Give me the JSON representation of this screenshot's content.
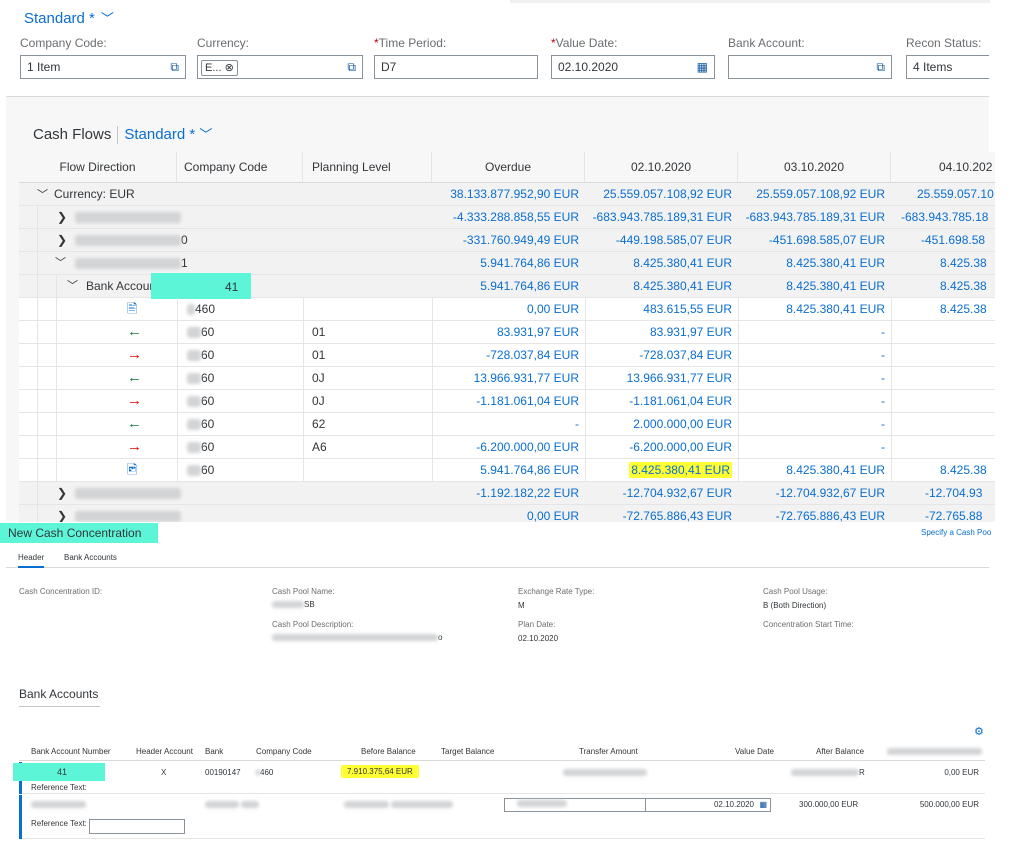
{
  "filter_bar": {
    "variant": "Standard *",
    "fields": {
      "company_code": {
        "label": "Company Code:",
        "value": "1 Item"
      },
      "currency": {
        "label": "Currency:",
        "token": "E..."
      },
      "time_period": {
        "required": "*",
        "label": "Time Period:",
        "value": "D7"
      },
      "value_date": {
        "required": "*",
        "label": "Value Date:",
        "value": "02.10.2020"
      },
      "bank_account": {
        "label": "Bank Account:",
        "value": ""
      },
      "recon_status": {
        "label": "Recon Status:",
        "value": "4 Items"
      }
    }
  },
  "cash_flows": {
    "title": "Cash Flows",
    "variant": "Standard *",
    "columns": [
      "Flow Direction",
      "Company Code",
      "Planning Level",
      "Overdue",
      "02.10.2020",
      "03.10.2020",
      "04.10.202"
    ],
    "currency_row": {
      "label": "Currency: EUR",
      "values": [
        "38.133.877.952,90 EUR",
        "25.559.057.108,92 EUR",
        "25.559.057.108,92 EUR",
        "25.559.057.10"
      ]
    },
    "house_banks": [
      {
        "suffix": "",
        "values": [
          "-4.333.288.858,55 EUR",
          "-683.943.785.189,31 EUR",
          "-683.943.785.189,31 EUR",
          "-683.943.785.18"
        ]
      },
      {
        "suffix": "0",
        "values": [
          "-331.760.949,49 EUR",
          "-449.198.585,07 EUR",
          "-451.698.585,07 EUR",
          "-451.698.58"
        ]
      },
      {
        "suffix": "1",
        "values": [
          "5.941.764,86 EUR",
          "8.425.380,41 EUR",
          "8.425.380,41 EUR",
          "8.425.38"
        ]
      }
    ],
    "bank_account_row": {
      "label": "Bank Account:",
      "suffix": "41",
      "values": [
        "5.941.764,86 EUR",
        "8.425.380,41 EUR",
        "8.425.380,41 EUR",
        "8.425.38"
      ]
    },
    "flows": [
      {
        "icon": "bank-statement-icon",
        "company": "460",
        "level": "",
        "values": [
          "0,00 EUR",
          "483.615,55 EUR",
          "8.425.380,41 EUR",
          "8.425.38"
        ]
      },
      {
        "icon": "inflow-arrow-icon",
        "company": "60",
        "level": "01",
        "values": [
          "83.931,97 EUR",
          "83.931,97 EUR",
          "-",
          ""
        ]
      },
      {
        "icon": "outflow-arrow-icon",
        "company": "60",
        "level": "01",
        "values": [
          "-728.037,84 EUR",
          "-728.037,84 EUR",
          "-",
          ""
        ]
      },
      {
        "icon": "inflow-arrow-icon",
        "company": "60",
        "level": "0J",
        "values": [
          "13.966.931,77 EUR",
          "13.966.931,77 EUR",
          "-",
          ""
        ]
      },
      {
        "icon": "outflow-arrow-icon",
        "company": "60",
        "level": "0J",
        "values": [
          "-1.181.061,04 EUR",
          "-1.181.061,04 EUR",
          "-",
          ""
        ]
      },
      {
        "icon": "inflow-arrow-icon",
        "company": "60",
        "level": "62",
        "values": [
          "-",
          "2.000.000,00 EUR",
          "-",
          ""
        ]
      },
      {
        "icon": "outflow-arrow-icon",
        "company": "60",
        "level": "A6",
        "values": [
          "-6.200.000,00 EUR",
          "-6.200.000,00 EUR",
          "-",
          ""
        ]
      },
      {
        "icon": "closing-balance-icon",
        "company": "60",
        "level": "",
        "values": [
          "5.941.764,86 EUR",
          "8.425.380,41 EUR",
          "8.425.380,41 EUR",
          "8.425.38"
        ]
      }
    ],
    "trailing_banks": [
      {
        "values": [
          "-1.192.182,22 EUR",
          "-12.704.932,67 EUR",
          "-12.704.932,67 EUR",
          "-12.704.93"
        ]
      },
      {
        "values": [
          "0,00 EUR",
          "-72.765.886,43 EUR",
          "-72.765.886,43 EUR",
          "-72.765.88"
        ]
      }
    ]
  },
  "cash_concentration": {
    "title": "New Cash Concentration",
    "link": "Specify a Cash Poo",
    "tabs": [
      "Header",
      "Bank Accounts"
    ],
    "header": {
      "id_label": "Cash Concentration ID:",
      "pool_name_label": "Cash Pool Name:",
      "pool_name_value": "SB",
      "pool_desc_label": "Cash Pool Description:",
      "pool_desc_value": "o",
      "rate_type_label": "Exchange Rate Type:",
      "rate_type_value": "M",
      "plan_date_label": "Plan Date:",
      "plan_date_value": "02.10.2020",
      "usage_label": "Cash Pool Usage:",
      "usage_value": "B (Both Direction)",
      "start_time_label": "Concentration Start Time:"
    },
    "bank_accounts_title": "Bank Accounts",
    "columns": [
      "Bank Account Number",
      "Header Account",
      "Bank",
      "Company Code",
      "Before Balance",
      "Target Balance",
      "Transfer Amount",
      "Value Date",
      "After Balance"
    ],
    "row1": {
      "account": "41",
      "header": "X",
      "bank": "00190147",
      "company": "460",
      "before": "7.910.375,64  EUR",
      "after_suffix": "R",
      "extra": "0,00  EUR",
      "ref_label": "Reference Text:"
    },
    "row2": {
      "date": "02.10.2020",
      "after": "300.000,00  EUR",
      "extra": "500.000,00  EUR",
      "ref_label": "Reference Text:"
    }
  }
}
